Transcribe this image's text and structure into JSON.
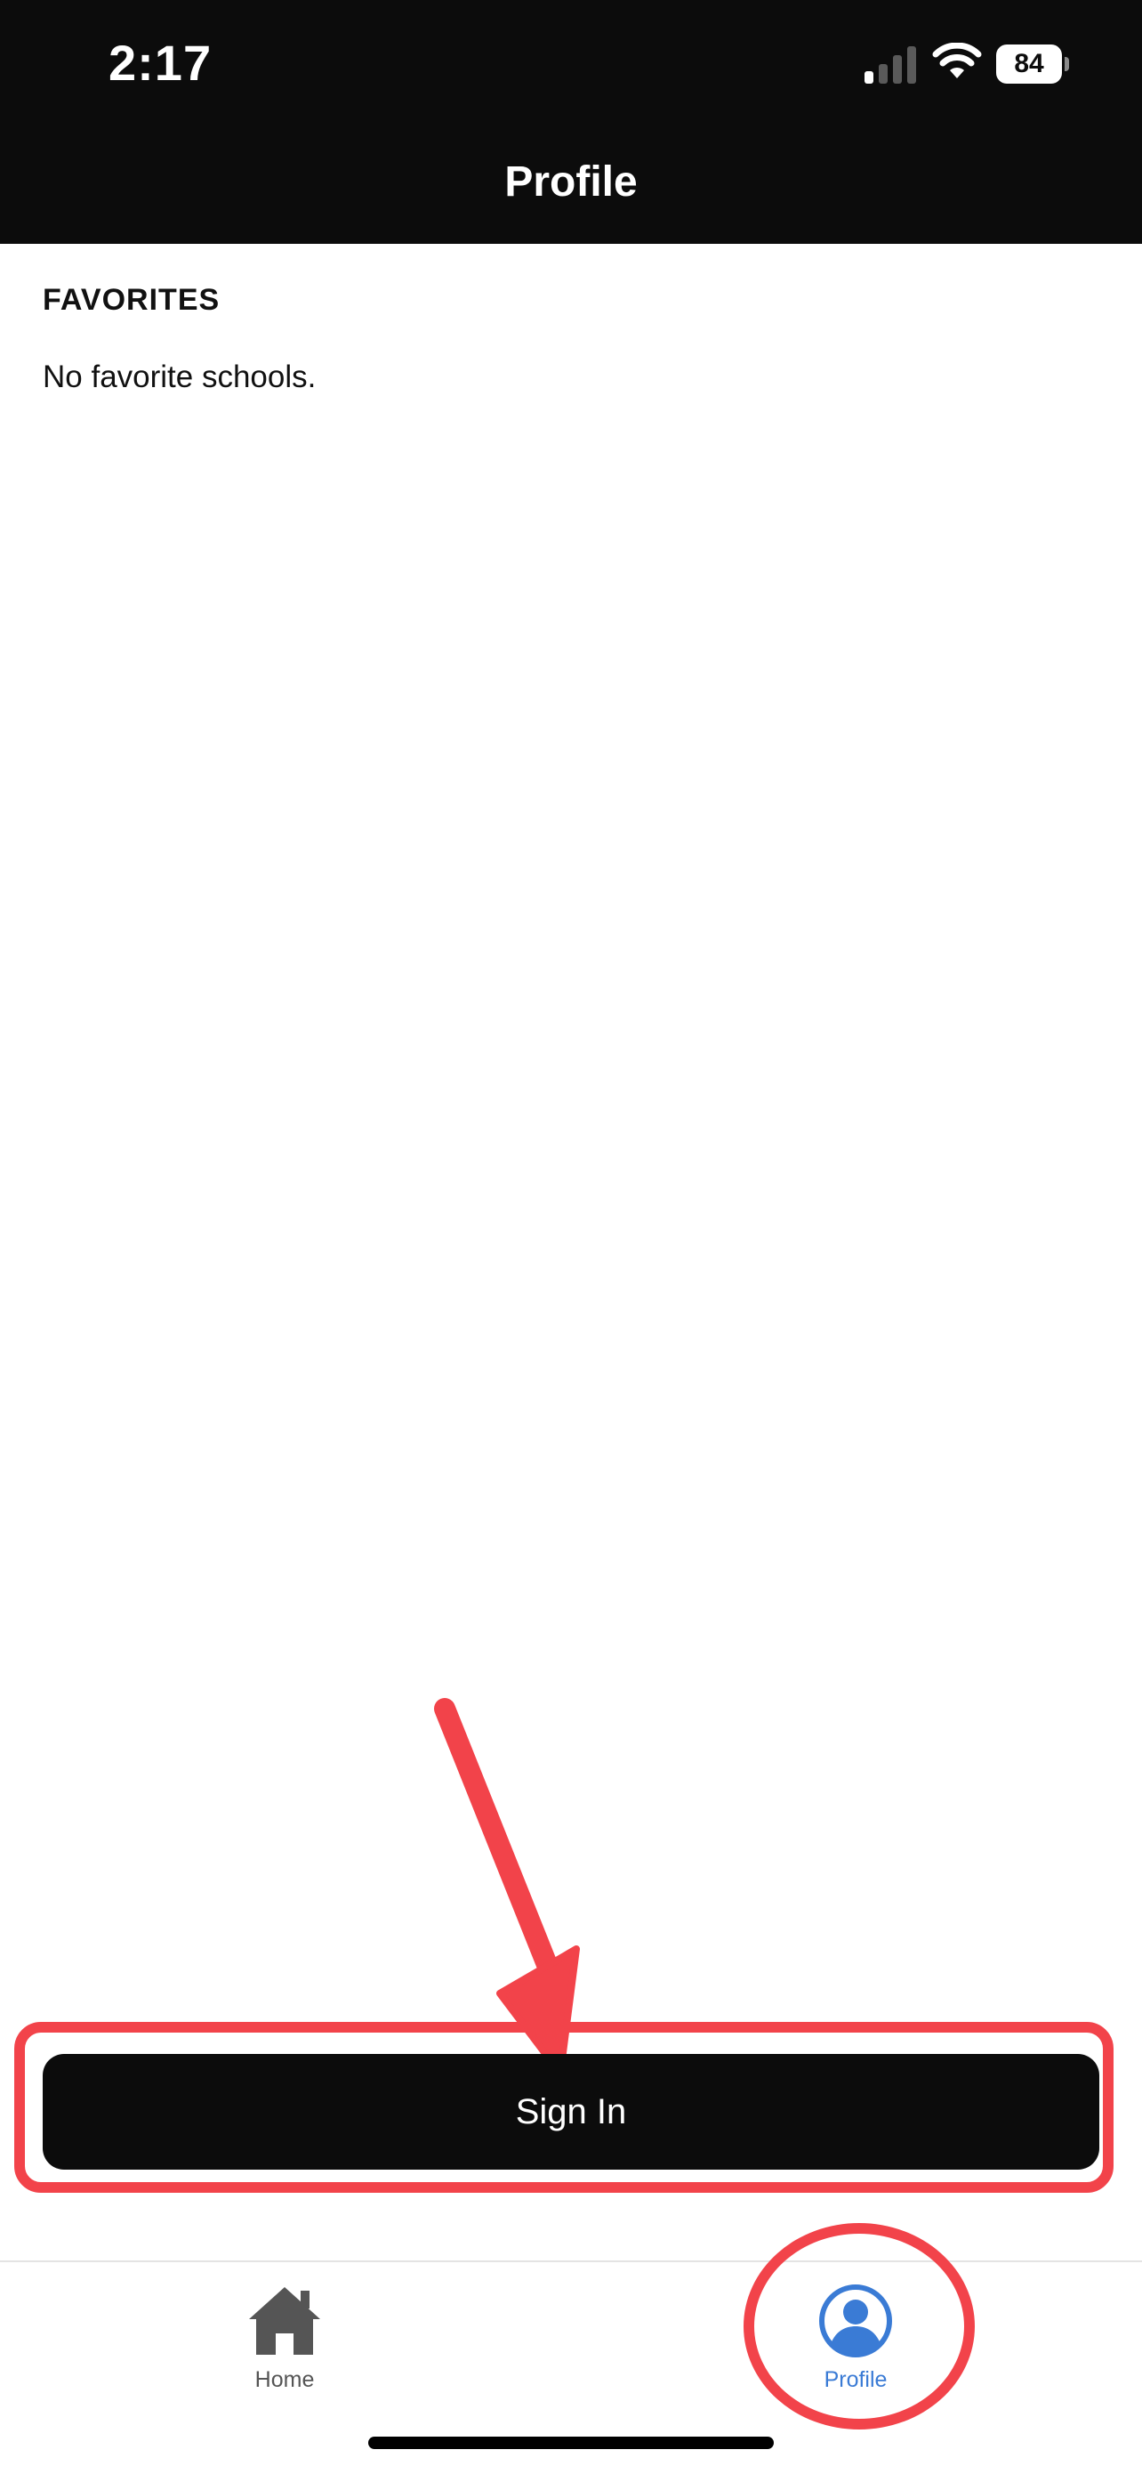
{
  "status_bar": {
    "time": "2:17",
    "battery_level": "84",
    "cellular_icon": "cellular-signal-icon",
    "wifi_icon": "wifi-icon"
  },
  "nav": {
    "title": "Profile"
  },
  "favorites": {
    "title": "FAVORITES",
    "empty_message": "No favorite schools."
  },
  "actions": {
    "sign_in_label": "Sign In"
  },
  "tabs": [
    {
      "label": "Home",
      "icon": "home-icon",
      "active": false
    },
    {
      "label": "Profile",
      "icon": "profile-icon",
      "active": true
    }
  ],
  "colors": {
    "header_bg": "#0c0c0c",
    "active_tab": "#3a7bd5",
    "inactive_tab": "#555555",
    "annotation": "#f2434a"
  }
}
